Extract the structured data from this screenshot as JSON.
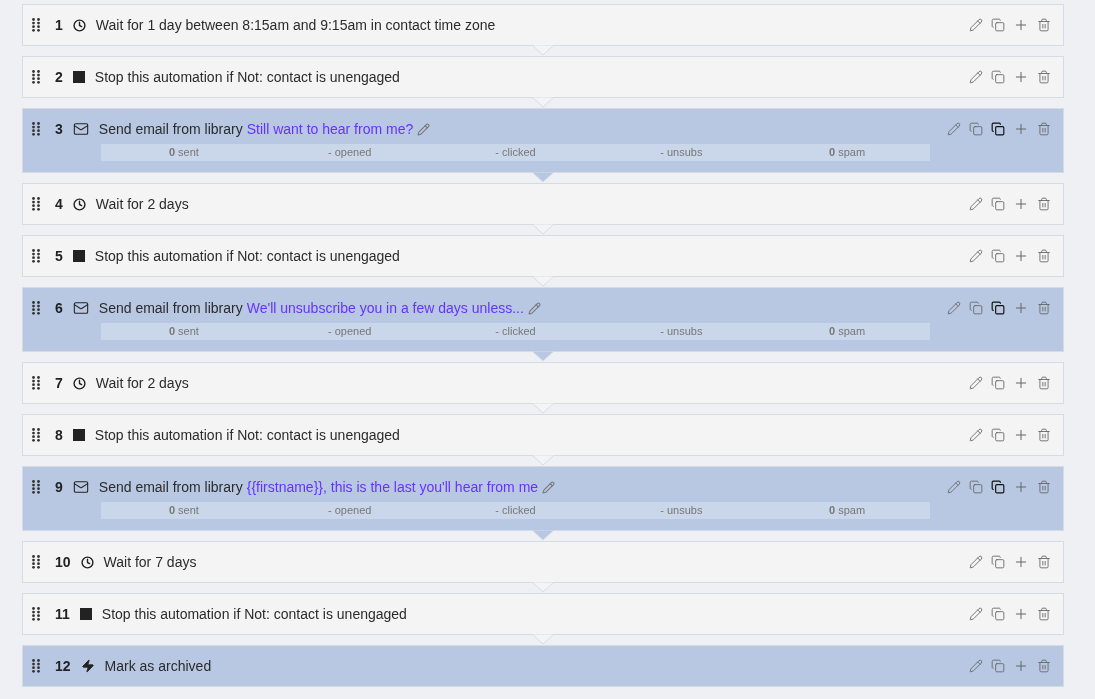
{
  "steps": [
    {
      "number": "1",
      "kind": "wait",
      "text": "Wait for 1 day between 8:15am and 9:15am in contact time zone"
    },
    {
      "number": "2",
      "kind": "stop",
      "text": "Stop this automation if Not: contact is unengaged"
    },
    {
      "number": "3",
      "kind": "email",
      "text": "Send email from library",
      "link": "Still want to hear from me?",
      "stats": [
        "**0** sent",
        "- opened",
        "- clicked",
        "- unsubs",
        "**0** spam"
      ]
    },
    {
      "number": "4",
      "kind": "wait",
      "text": "Wait for 2 days"
    },
    {
      "number": "5",
      "kind": "stop",
      "text": "Stop this automation if Not: contact is unengaged"
    },
    {
      "number": "6",
      "kind": "email",
      "text": "Send email from library",
      "link": "We'll unsubscribe you in a few days unless...",
      "stats": [
        "**0** sent",
        "- opened",
        "- clicked",
        "- unsubs",
        "**0** spam"
      ]
    },
    {
      "number": "7",
      "kind": "wait",
      "text": "Wait for 2 days"
    },
    {
      "number": "8",
      "kind": "stop",
      "text": "Stop this automation if Not: contact is unengaged"
    },
    {
      "number": "9",
      "kind": "email",
      "text": "Send email from library",
      "link": "{{firstname}}, this is the last you'll hear from me",
      "stats": [
        "**0** sent",
        "- opened",
        "- clicked",
        "- unsubs",
        "**0** spam"
      ]
    },
    {
      "number": "10",
      "kind": "wait",
      "text": "Wait for 7 days"
    },
    {
      "number": "11",
      "kind": "stop",
      "text": "Stop this automation if Not: contact is unengaged"
    },
    {
      "number": "12",
      "kind": "action",
      "text": "Mark as archived"
    }
  ]
}
